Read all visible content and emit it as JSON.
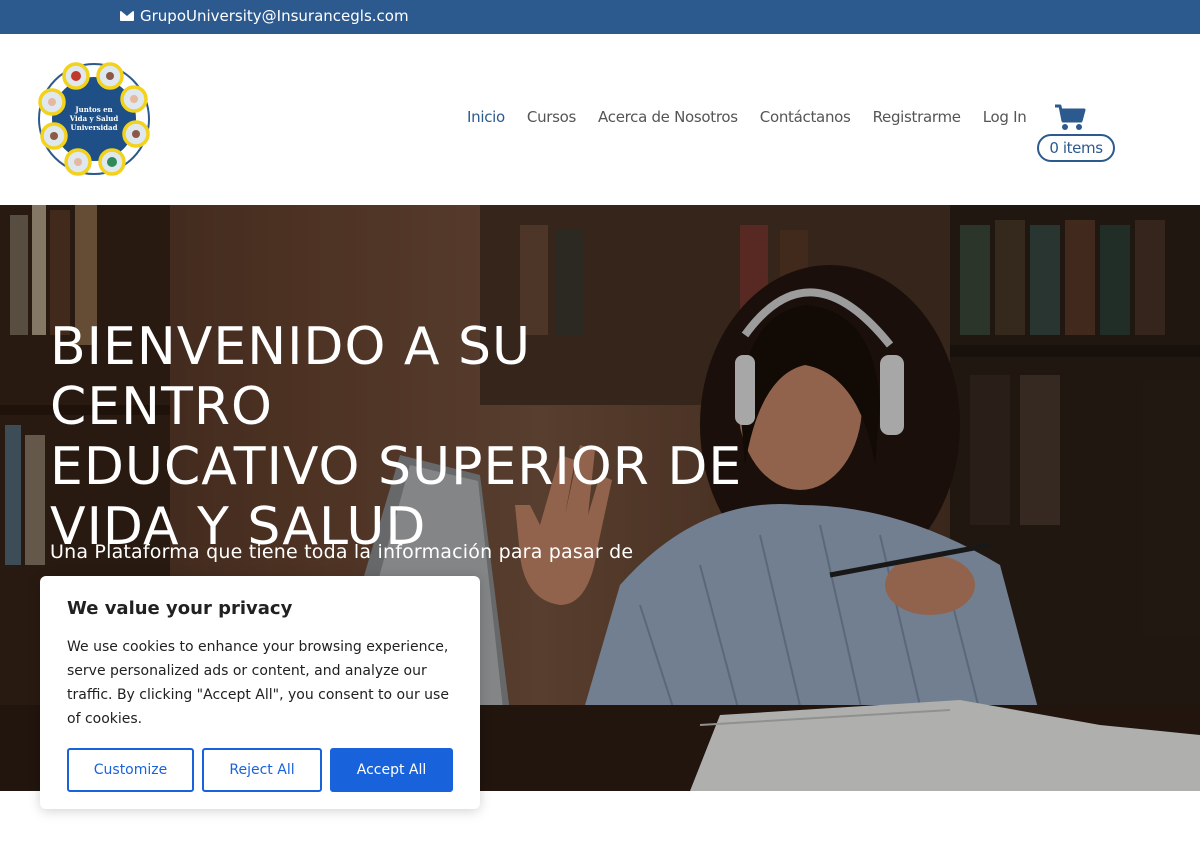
{
  "topbar": {
    "email": "GrupoUniversity@Insurancegls.com",
    "icon": "envelope-icon"
  },
  "header": {
    "logo_text": [
      "Juntos en",
      "Vida y Salud",
      "Universidad"
    ],
    "nav": [
      {
        "label": "Inicio",
        "active": true
      },
      {
        "label": "Cursos"
      },
      {
        "label": "Acerca de Nosotros"
      },
      {
        "label": "Contáctanos"
      },
      {
        "label": "Registrarme"
      },
      {
        "label": "Log In"
      }
    ],
    "cart": {
      "icon": "shopping-cart-icon",
      "count_label": "0 items"
    }
  },
  "hero": {
    "title_lines": [
      "BIENVENIDO A SU CENTRO",
      "EDUCATIVO SUPERIOR DE",
      "VIDA Y SALUD"
    ],
    "subtitle": "Una Plataforma que tiene toda la información para pasar de"
  },
  "cookie_banner": {
    "title": "We value your privacy",
    "body": "We use cookies to enhance your browsing experience, serve personalized ads or content, and analyze our traffic. By clicking \"Accept All\", you consent to our use of cookies.",
    "buttons": {
      "customize": "Customize",
      "reject": "Reject All",
      "accept": "Accept All"
    }
  },
  "colors": {
    "brand_blue": "#2c5a8e",
    "accept_blue": "#1863dc",
    "logo_yellow": "#f2d21b"
  }
}
